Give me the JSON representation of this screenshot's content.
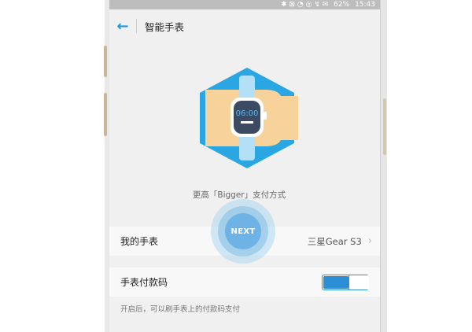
{
  "status_bar": {
    "icons_left": "✱ ⊠ ◔ ◎ ↯ ✉",
    "battery": "62%",
    "time": "15:43"
  },
  "app_bar": {
    "back_icon": "←",
    "title": "智能手表"
  },
  "hero": {
    "watch_time": "06:00",
    "caption": "更高「Bigger」支付方式"
  },
  "next_button": {
    "label": "NEXT"
  },
  "rows": {
    "my_watch": {
      "label": "我的手表",
      "value": "三星Gear S3",
      "chevron": "›"
    },
    "watch_pay": {
      "label": "手表付款码",
      "toggle_on": true
    }
  },
  "hint": "开启后，可以刷手表上的付款码支付",
  "colors": {
    "accent": "#2196d8",
    "hex_blue": "#2aa6e2",
    "hand_skin": "#f8d29b",
    "band": "#b3dff7",
    "watch_face": "#3c4a63"
  }
}
